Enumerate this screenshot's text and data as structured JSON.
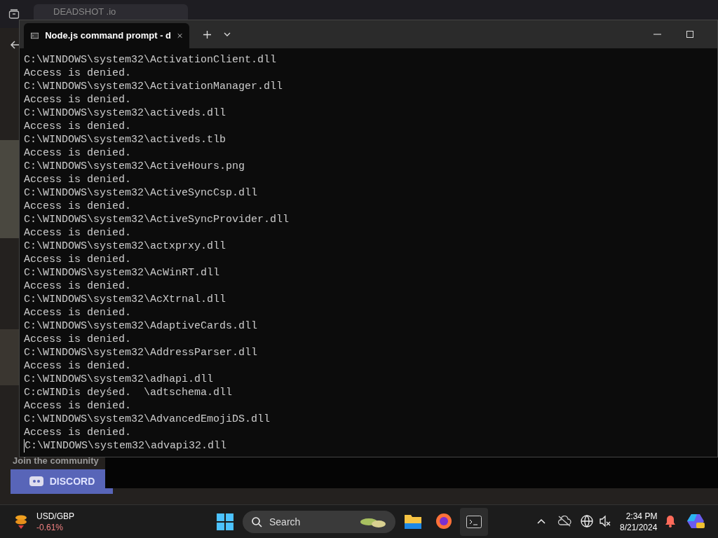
{
  "browser": {
    "tab_title": "DEADSHOT .io",
    "community_label": "Join the community",
    "discord_button": "DISCORD"
  },
  "terminal": {
    "tab_title": "Node.js command prompt - d",
    "lines": [
      "C:\\WINDOWS\\system32\\ActivationClient.dll",
      "Access is denied.",
      "C:\\WINDOWS\\system32\\ActivationManager.dll",
      "Access is denied.",
      "C:\\WINDOWS\\system32\\activeds.dll",
      "Access is denied.",
      "C:\\WINDOWS\\system32\\activeds.tlb",
      "Access is denied.",
      "C:\\WINDOWS\\system32\\ActiveHours.png",
      "Access is denied.",
      "C:\\WINDOWS\\system32\\ActiveSyncCsp.dll",
      "Access is denied.",
      "C:\\WINDOWS\\system32\\ActiveSyncProvider.dll",
      "Access is denied.",
      "C:\\WINDOWS\\system32\\actxprxy.dll",
      "Access is denied.",
      "C:\\WINDOWS\\system32\\AcWinRT.dll",
      "Access is denied.",
      "C:\\WINDOWS\\system32\\AcXtrnal.dll",
      "Access is denied.",
      "C:\\WINDOWS\\system32\\AdaptiveCards.dll",
      "Access is denied.",
      "C:\\WINDOWS\\system32\\AddressParser.dll",
      "Access is denied.",
      "C:\\WINDOWS\\system32\\adhapi.dll",
      "C:cWINDis deyśed.  \\adtschema.dll",
      "Access is denied.",
      "C:\\WINDOWS\\system32\\AdvancedEmojiDS.dll",
      "Access is denied.",
      "C:\\WINDOWS\\system32\\advapi32.dll"
    ]
  },
  "taskbar": {
    "widget_title": "USD/GBP",
    "widget_change": "-0.61%",
    "search_placeholder": "Search",
    "time": "2:34 PM",
    "date": "8/21/2024"
  }
}
